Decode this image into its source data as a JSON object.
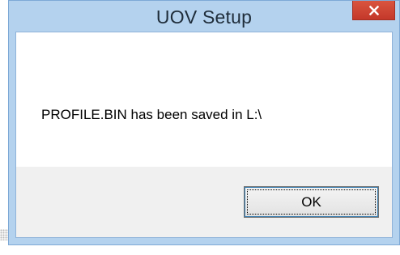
{
  "window": {
    "title": "UOV Setup",
    "close_icon": "close-icon",
    "close_color": "#c7402d"
  },
  "dialog": {
    "message": "PROFILE.BIN has been saved in L:\\",
    "ok_label": "OK"
  }
}
